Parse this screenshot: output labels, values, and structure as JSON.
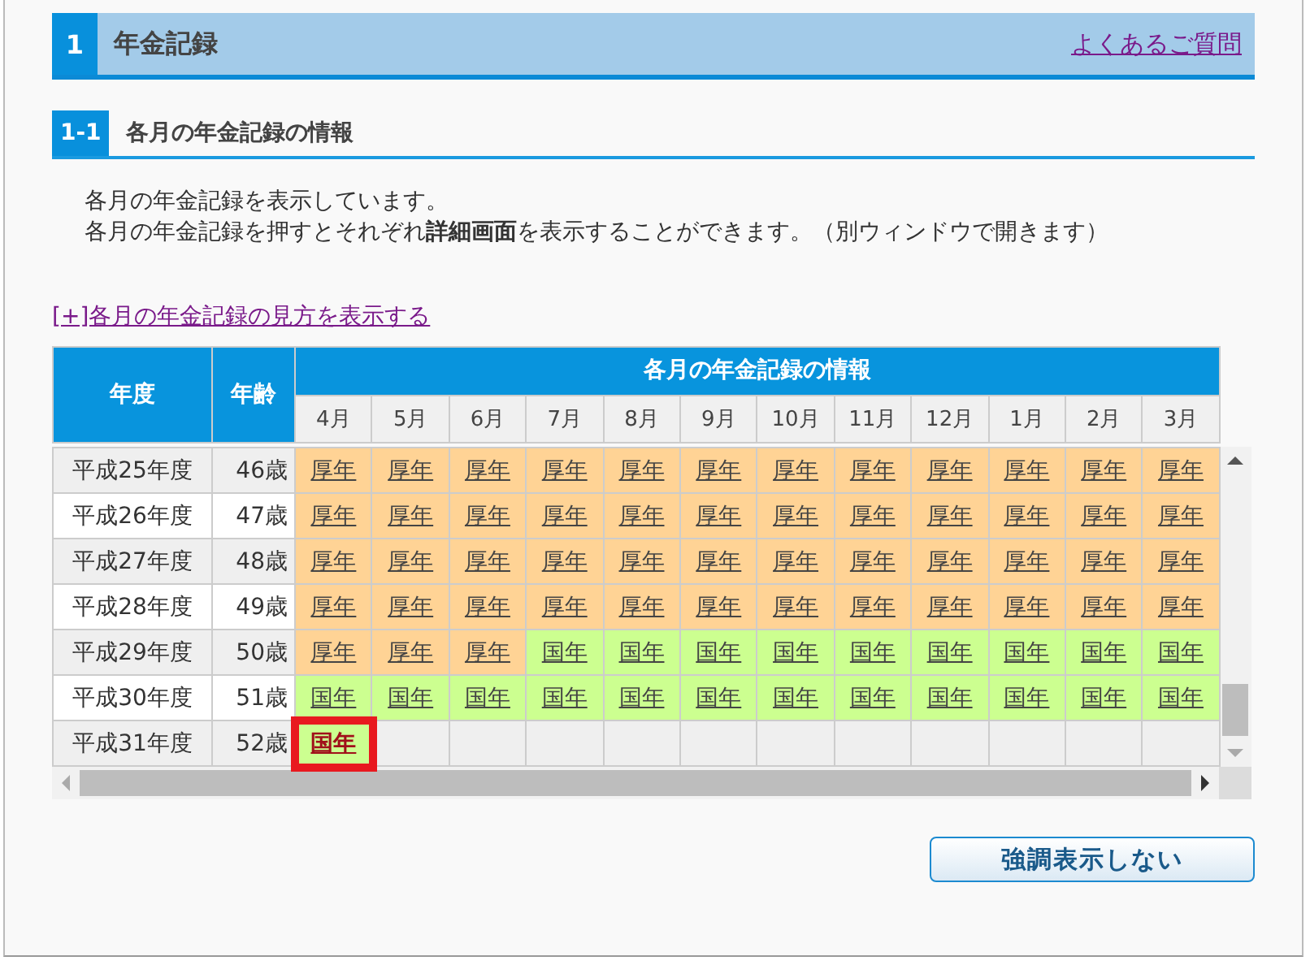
{
  "section": {
    "number": "1",
    "title": "年金記録",
    "faq_link": "よくあるご質問"
  },
  "subsection": {
    "number": "1-1",
    "title": "各月の年金記録の情報"
  },
  "description": [
    "各月の年金記録を表示しています。",
    "各月の年金記録を押すとそれぞれ**詳細画面**を表示することができます。（別ウィンドウで開きます）"
  ],
  "toggle_link": "[+]各月の年金記録の見方を表示する",
  "table": {
    "columns": [
      "年度",
      "年齢"
    ],
    "group_header": "各月の年金記録の情報",
    "months": [
      "4月",
      "5月",
      "6月",
      "7月",
      "8月",
      "9月",
      "10月",
      "11月",
      "12月",
      "1月",
      "2月",
      "3月"
    ],
    "rows": [
      {
        "year": "平成25年度",
        "age": "46歳",
        "cells": [
          {
            "text": "厚年",
            "kind": "kosei"
          },
          {
            "text": "厚年",
            "kind": "kosei"
          },
          {
            "text": "厚年",
            "kind": "kosei"
          },
          {
            "text": "厚年",
            "kind": "kosei"
          },
          {
            "text": "厚年",
            "kind": "kosei"
          },
          {
            "text": "厚年",
            "kind": "kosei"
          },
          {
            "text": "厚年",
            "kind": "kosei"
          },
          {
            "text": "厚年",
            "kind": "kosei"
          },
          {
            "text": "厚年",
            "kind": "kosei"
          },
          {
            "text": "厚年",
            "kind": "kosei"
          },
          {
            "text": "厚年",
            "kind": "kosei"
          },
          {
            "text": "厚年",
            "kind": "kosei"
          }
        ]
      },
      {
        "year": "平成26年度",
        "age": "47歳",
        "cells": [
          {
            "text": "厚年",
            "kind": "kosei"
          },
          {
            "text": "厚年",
            "kind": "kosei"
          },
          {
            "text": "厚年",
            "kind": "kosei"
          },
          {
            "text": "厚年",
            "kind": "kosei"
          },
          {
            "text": "厚年",
            "kind": "kosei"
          },
          {
            "text": "厚年",
            "kind": "kosei"
          },
          {
            "text": "厚年",
            "kind": "kosei"
          },
          {
            "text": "厚年",
            "kind": "kosei"
          },
          {
            "text": "厚年",
            "kind": "kosei"
          },
          {
            "text": "厚年",
            "kind": "kosei"
          },
          {
            "text": "厚年",
            "kind": "kosei"
          },
          {
            "text": "厚年",
            "kind": "kosei"
          }
        ]
      },
      {
        "year": "平成27年度",
        "age": "48歳",
        "cells": [
          {
            "text": "厚年",
            "kind": "kosei"
          },
          {
            "text": "厚年",
            "kind": "kosei"
          },
          {
            "text": "厚年",
            "kind": "kosei"
          },
          {
            "text": "厚年",
            "kind": "kosei"
          },
          {
            "text": "厚年",
            "kind": "kosei"
          },
          {
            "text": "厚年",
            "kind": "kosei"
          },
          {
            "text": "厚年",
            "kind": "kosei"
          },
          {
            "text": "厚年",
            "kind": "kosei"
          },
          {
            "text": "厚年",
            "kind": "kosei"
          },
          {
            "text": "厚年",
            "kind": "kosei"
          },
          {
            "text": "厚年",
            "kind": "kosei"
          },
          {
            "text": "厚年",
            "kind": "kosei"
          }
        ]
      },
      {
        "year": "平成28年度",
        "age": "49歳",
        "cells": [
          {
            "text": "厚年",
            "kind": "kosei"
          },
          {
            "text": "厚年",
            "kind": "kosei"
          },
          {
            "text": "厚年",
            "kind": "kosei"
          },
          {
            "text": "厚年",
            "kind": "kosei"
          },
          {
            "text": "厚年",
            "kind": "kosei"
          },
          {
            "text": "厚年",
            "kind": "kosei"
          },
          {
            "text": "厚年",
            "kind": "kosei"
          },
          {
            "text": "厚年",
            "kind": "kosei"
          },
          {
            "text": "厚年",
            "kind": "kosei"
          },
          {
            "text": "厚年",
            "kind": "kosei"
          },
          {
            "text": "厚年",
            "kind": "kosei"
          },
          {
            "text": "厚年",
            "kind": "kosei"
          }
        ]
      },
      {
        "year": "平成29年度",
        "age": "50歳",
        "cells": [
          {
            "text": "厚年",
            "kind": "kosei"
          },
          {
            "text": "厚年",
            "kind": "kosei"
          },
          {
            "text": "厚年",
            "kind": "kosei"
          },
          {
            "text": "国年",
            "kind": "kokunen"
          },
          {
            "text": "国年",
            "kind": "kokunen"
          },
          {
            "text": "国年",
            "kind": "kokunen"
          },
          {
            "text": "国年",
            "kind": "kokunen"
          },
          {
            "text": "国年",
            "kind": "kokunen"
          },
          {
            "text": "国年",
            "kind": "kokunen"
          },
          {
            "text": "国年",
            "kind": "kokunen"
          },
          {
            "text": "国年",
            "kind": "kokunen"
          },
          {
            "text": "国年",
            "kind": "kokunen"
          }
        ]
      },
      {
        "year": "平成30年度",
        "age": "51歳",
        "cells": [
          {
            "text": "国年",
            "kind": "kokunen"
          },
          {
            "text": "国年",
            "kind": "kokunen"
          },
          {
            "text": "国年",
            "kind": "kokunen"
          },
          {
            "text": "国年",
            "kind": "kokunen"
          },
          {
            "text": "国年",
            "kind": "kokunen"
          },
          {
            "text": "国年",
            "kind": "kokunen"
          },
          {
            "text": "国年",
            "kind": "kokunen"
          },
          {
            "text": "国年",
            "kind": "kokunen"
          },
          {
            "text": "国年",
            "kind": "kokunen"
          },
          {
            "text": "国年",
            "kind": "kokunen"
          },
          {
            "text": "国年",
            "kind": "kokunen"
          },
          {
            "text": "国年",
            "kind": "kokunen"
          }
        ]
      },
      {
        "year": "平成31年度",
        "age": "52歳",
        "cells": [
          {
            "text": "国年",
            "kind": "kokunen",
            "highlighted": true
          },
          {
            "kind": "empty"
          },
          {
            "kind": "empty"
          },
          {
            "kind": "empty"
          },
          {
            "kind": "empty"
          },
          {
            "kind": "empty"
          },
          {
            "kind": "empty"
          },
          {
            "kind": "empty"
          },
          {
            "kind": "empty"
          },
          {
            "kind": "empty"
          },
          {
            "kind": "empty"
          },
          {
            "kind": "empty"
          }
        ]
      }
    ]
  },
  "button": "強調表示しない"
}
